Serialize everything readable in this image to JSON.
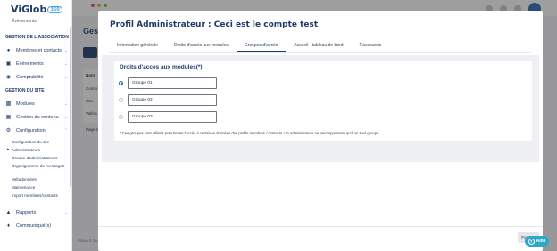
{
  "sidebar": {
    "logo_text": "ViGlob",
    "logo_badge": "360",
    "top_sub_label": "Événements",
    "section_association": "GESTION DE L'ASSOCIATION",
    "items_association": [
      {
        "label": "Membres et contacts",
        "icon": "users-icon"
      },
      {
        "label": "Événements",
        "icon": "folder-icon"
      },
      {
        "label": "Comptabilité",
        "icon": "coins-icon"
      }
    ],
    "section_site": "GESTION DU SITE",
    "items_site": [
      {
        "label": "Modules",
        "icon": "modules-icon"
      },
      {
        "label": "Gestion du contenu",
        "icon": "content-icon"
      },
      {
        "label": "Configuration",
        "icon": "gears-icon"
      }
    ],
    "config_subitems": [
      "Configuration du site",
      "Administrateurs",
      "Groupe d'administrateurs",
      "Organigramme de messages",
      "Métadonnées",
      "Maintenance",
      "Import membres/contacts"
    ],
    "items_bottom": [
      {
        "label": "Rapports",
        "icon": "chart-icon"
      },
      {
        "label": "Communiqué(s)",
        "icon": "bell-icon"
      }
    ]
  },
  "background": {
    "page_title": "Gest",
    "rows": [
      "Nom",
      "Comm",
      "dtrix",
      "Valéra",
      "Page 1"
    ],
    "footer": "ViGlob © 20"
  },
  "modal": {
    "title": "Profil Administrateur : Ceci est le compte test",
    "tabs": [
      {
        "label": "Information générale",
        "active": false
      },
      {
        "label": "Droits d'accès aux modules",
        "active": false
      },
      {
        "label": "Groupes d'accès",
        "active": true
      },
      {
        "label": "Accueil - tableau de bord",
        "active": false
      },
      {
        "label": "Raccourcis",
        "active": false
      }
    ],
    "panel_title": "Droits d'accès aux modules(*)",
    "groups": [
      {
        "label": "Groupe 01",
        "checked": true
      },
      {
        "label": "Groupe 02",
        "checked": false
      },
      {
        "label": "Groupe 03",
        "checked": false
      }
    ],
    "note": "* Ces groupes sont utilisés pour limiter l'accès à certaines données des profils membres / contacts. Un administrateur ne peut appartenir qu'à un seul groupe",
    "close_label": "Fermer"
  },
  "help": {
    "label": "Aide",
    "icon": "question-icon"
  },
  "colors": {
    "brand": "#1f3a6b",
    "accent": "#2aa9c9",
    "overlay": "rgba(40,40,40,0.45)"
  }
}
